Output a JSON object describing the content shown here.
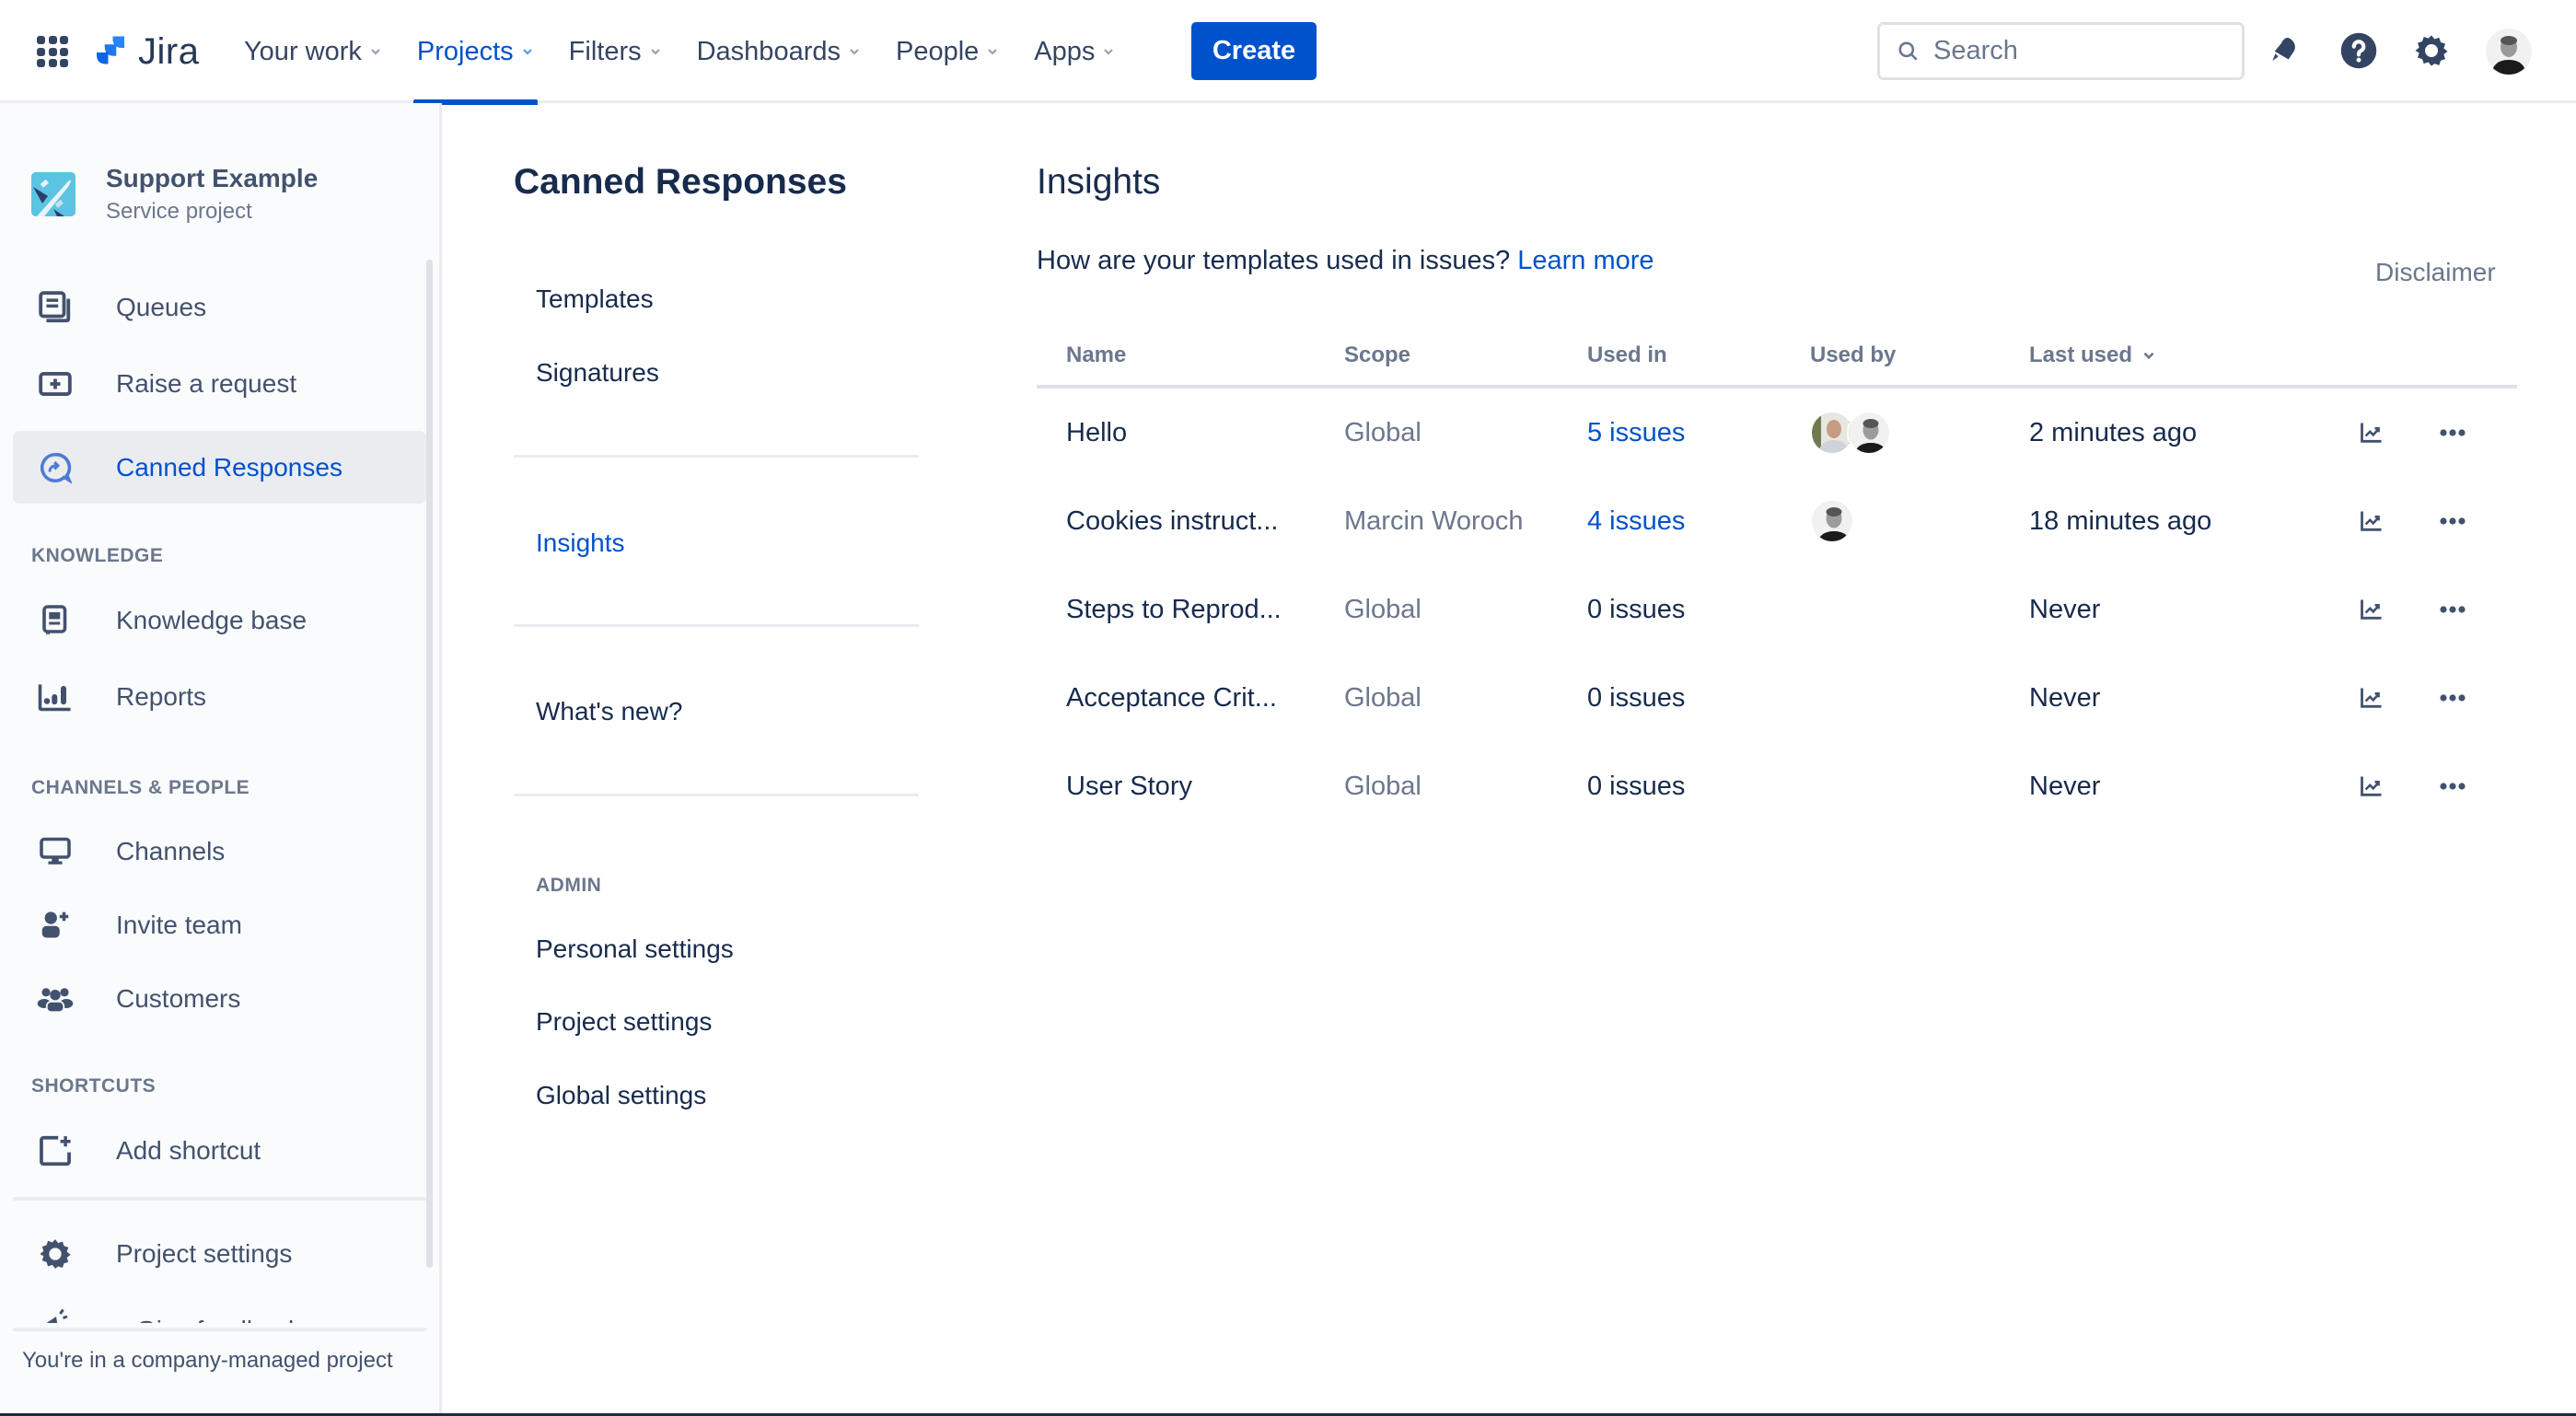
{
  "topnav": {
    "logo_text": "Jira",
    "items": [
      {
        "label": "Your work",
        "active": false
      },
      {
        "label": "Projects",
        "active": true
      },
      {
        "label": "Filters",
        "active": false
      },
      {
        "label": "Dashboards",
        "active": false
      },
      {
        "label": "People",
        "active": false
      },
      {
        "label": "Apps",
        "active": false
      }
    ],
    "create_label": "Create",
    "search_placeholder": "Search",
    "icons": [
      "notifications-icon",
      "help-icon",
      "settings-icon",
      "user-avatar"
    ],
    "accent_color": "#0052cc"
  },
  "sidebar": {
    "project_name": "Support Example",
    "project_type": "Service project",
    "items_main": [
      {
        "label": "Queues",
        "icon": "queues-icon"
      },
      {
        "label": "Raise a request",
        "icon": "raise-request-icon"
      },
      {
        "label": "Canned Responses",
        "icon": "canned-responses-icon",
        "active": true
      }
    ],
    "knowledge_heading": "KNOWLEDGE",
    "items_knowledge": [
      {
        "label": "Knowledge base",
        "icon": "knowledge-base-icon"
      },
      {
        "label": "Reports",
        "icon": "reports-icon"
      }
    ],
    "channels_heading": "CHANNELS & PEOPLE",
    "items_channels": [
      {
        "label": "Channels",
        "icon": "monitor-icon"
      },
      {
        "label": "Invite team",
        "icon": "invite-user-icon"
      },
      {
        "label": "Customers",
        "icon": "customers-icon"
      }
    ],
    "shortcuts_heading": "SHORTCUTS",
    "add_shortcut_label": "Add shortcut",
    "project_settings_label": "Project settings",
    "give_feedback_label": "Give feedback",
    "footer_text": "You're in a company-managed project"
  },
  "secondary_nav": {
    "title": "Canned Responses",
    "items_top": [
      "Templates",
      "Signatures"
    ],
    "insights_label": "Insights",
    "whats_new_label": "What's new?",
    "admin_heading": "ADMIN",
    "admin_items": [
      "Personal settings",
      "Project settings",
      "Global settings"
    ]
  },
  "main": {
    "title": "Insights",
    "description": "How are your templates used in issues?",
    "learn_more": "Learn more",
    "disclaimer": "Disclaimer",
    "columns": [
      "Name",
      "Scope",
      "Used in",
      "Used by",
      "Last used"
    ],
    "sort_column": "Last used",
    "sort_direction": "descending",
    "rows": [
      {
        "name": "Hello",
        "scope": "Global",
        "used_in": "5 issues",
        "used_in_link": true,
        "used_by_count": 2,
        "last_used": "2 minutes ago"
      },
      {
        "name": "Cookies instruct...",
        "scope": "Marcin Woroch",
        "used_in": "4 issues",
        "used_in_link": true,
        "used_by_count": 1,
        "last_used": "18 minutes ago"
      },
      {
        "name": "Steps to Reprod...",
        "scope": "Global",
        "used_in": "0 issues",
        "used_in_link": false,
        "used_by_count": 0,
        "last_used": "Never"
      },
      {
        "name": "Acceptance Crit...",
        "scope": "Global",
        "used_in": "0 issues",
        "used_in_link": false,
        "used_by_count": 0,
        "last_used": "Never"
      },
      {
        "name": "User Story",
        "scope": "Global",
        "used_in": "0 issues",
        "used_in_link": false,
        "used_by_count": 0,
        "last_used": "Never"
      }
    ]
  }
}
